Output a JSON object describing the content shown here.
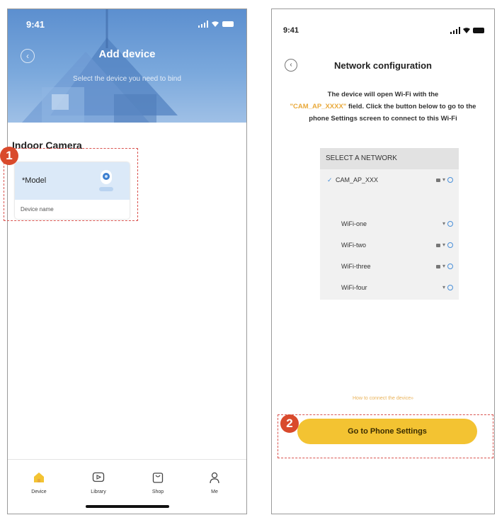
{
  "left_screen": {
    "status": {
      "time": "9:41"
    },
    "header": {
      "title": "Add device",
      "subtitle": "Select the device you need to bind"
    },
    "section_title": "Indoor Camera",
    "step_badge": "1",
    "device_card": {
      "model_label": "*Model",
      "name_placeholder": "Device name"
    },
    "tabbar": [
      {
        "label": "Device",
        "icon": "home-icon"
      },
      {
        "label": "Library",
        "icon": "play-icon"
      },
      {
        "label": "Shop",
        "icon": "bag-icon"
      },
      {
        "label": "Me",
        "icon": "person-icon"
      }
    ]
  },
  "right_screen": {
    "status": {
      "time": "9:41"
    },
    "title": "Network configuration",
    "description": {
      "part1": "The device will open Wi-Fi with the",
      "highlight": "\"CAM_AP_XXXX\"",
      "part2": "field. Click the button below to go to the phone Settings screen to connect to this Wi-Fi"
    },
    "network_list": {
      "header": "SELECT A NETWORK",
      "selected": {
        "name": "CAM_AP_XXX",
        "locked": true
      },
      "others": [
        {
          "name": "WiFi-one",
          "locked": false
        },
        {
          "name": "WiFi-two",
          "locked": true
        },
        {
          "name": "WiFi-three",
          "locked": true
        },
        {
          "name": "WiFi-four",
          "locked": false
        }
      ]
    },
    "help_link": "How to connect the device»",
    "step_badge": "2",
    "primary_button": "Go to Phone Settings"
  },
  "colors": {
    "header_blue": "#6f9fd8",
    "accent_yellow": "#f3c332",
    "highlight_orange": "#e9a93a",
    "badge_red": "#d94a2c",
    "dash_red": "#d9534f"
  }
}
